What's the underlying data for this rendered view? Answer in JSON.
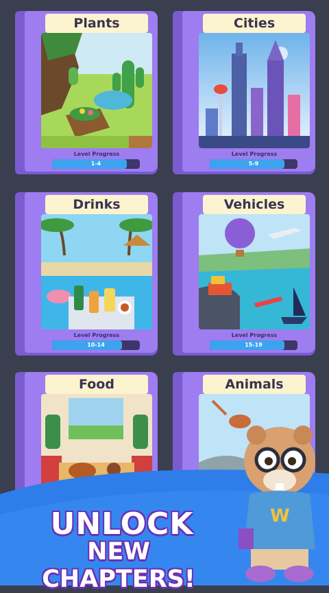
{
  "chapters": [
    {
      "title": "Plants",
      "progress_label": "Level Progress",
      "range": "1-4",
      "progress": 0.85
    },
    {
      "title": "Cities",
      "progress_label": "Level Progress",
      "range": "5-9",
      "progress": 0.85
    },
    {
      "title": "Drinks",
      "progress_label": "Level Progress",
      "range": "10-14",
      "progress": 0.8
    },
    {
      "title": "Vehicles",
      "progress_label": "Level Progress",
      "range": "15-19",
      "progress": 0.85
    },
    {
      "title": "Food"
    },
    {
      "title": "Animals"
    }
  ],
  "promo": {
    "line1": "UNLOCK",
    "line2": "NEW CHAPTERS!"
  },
  "colors": {
    "background": "#3a3f4f",
    "book_cover": "#9d7df0",
    "title_plate": "#fbf4cf",
    "progress_fill": "#3ea3ee",
    "banner_blue": "#2f7de8"
  }
}
